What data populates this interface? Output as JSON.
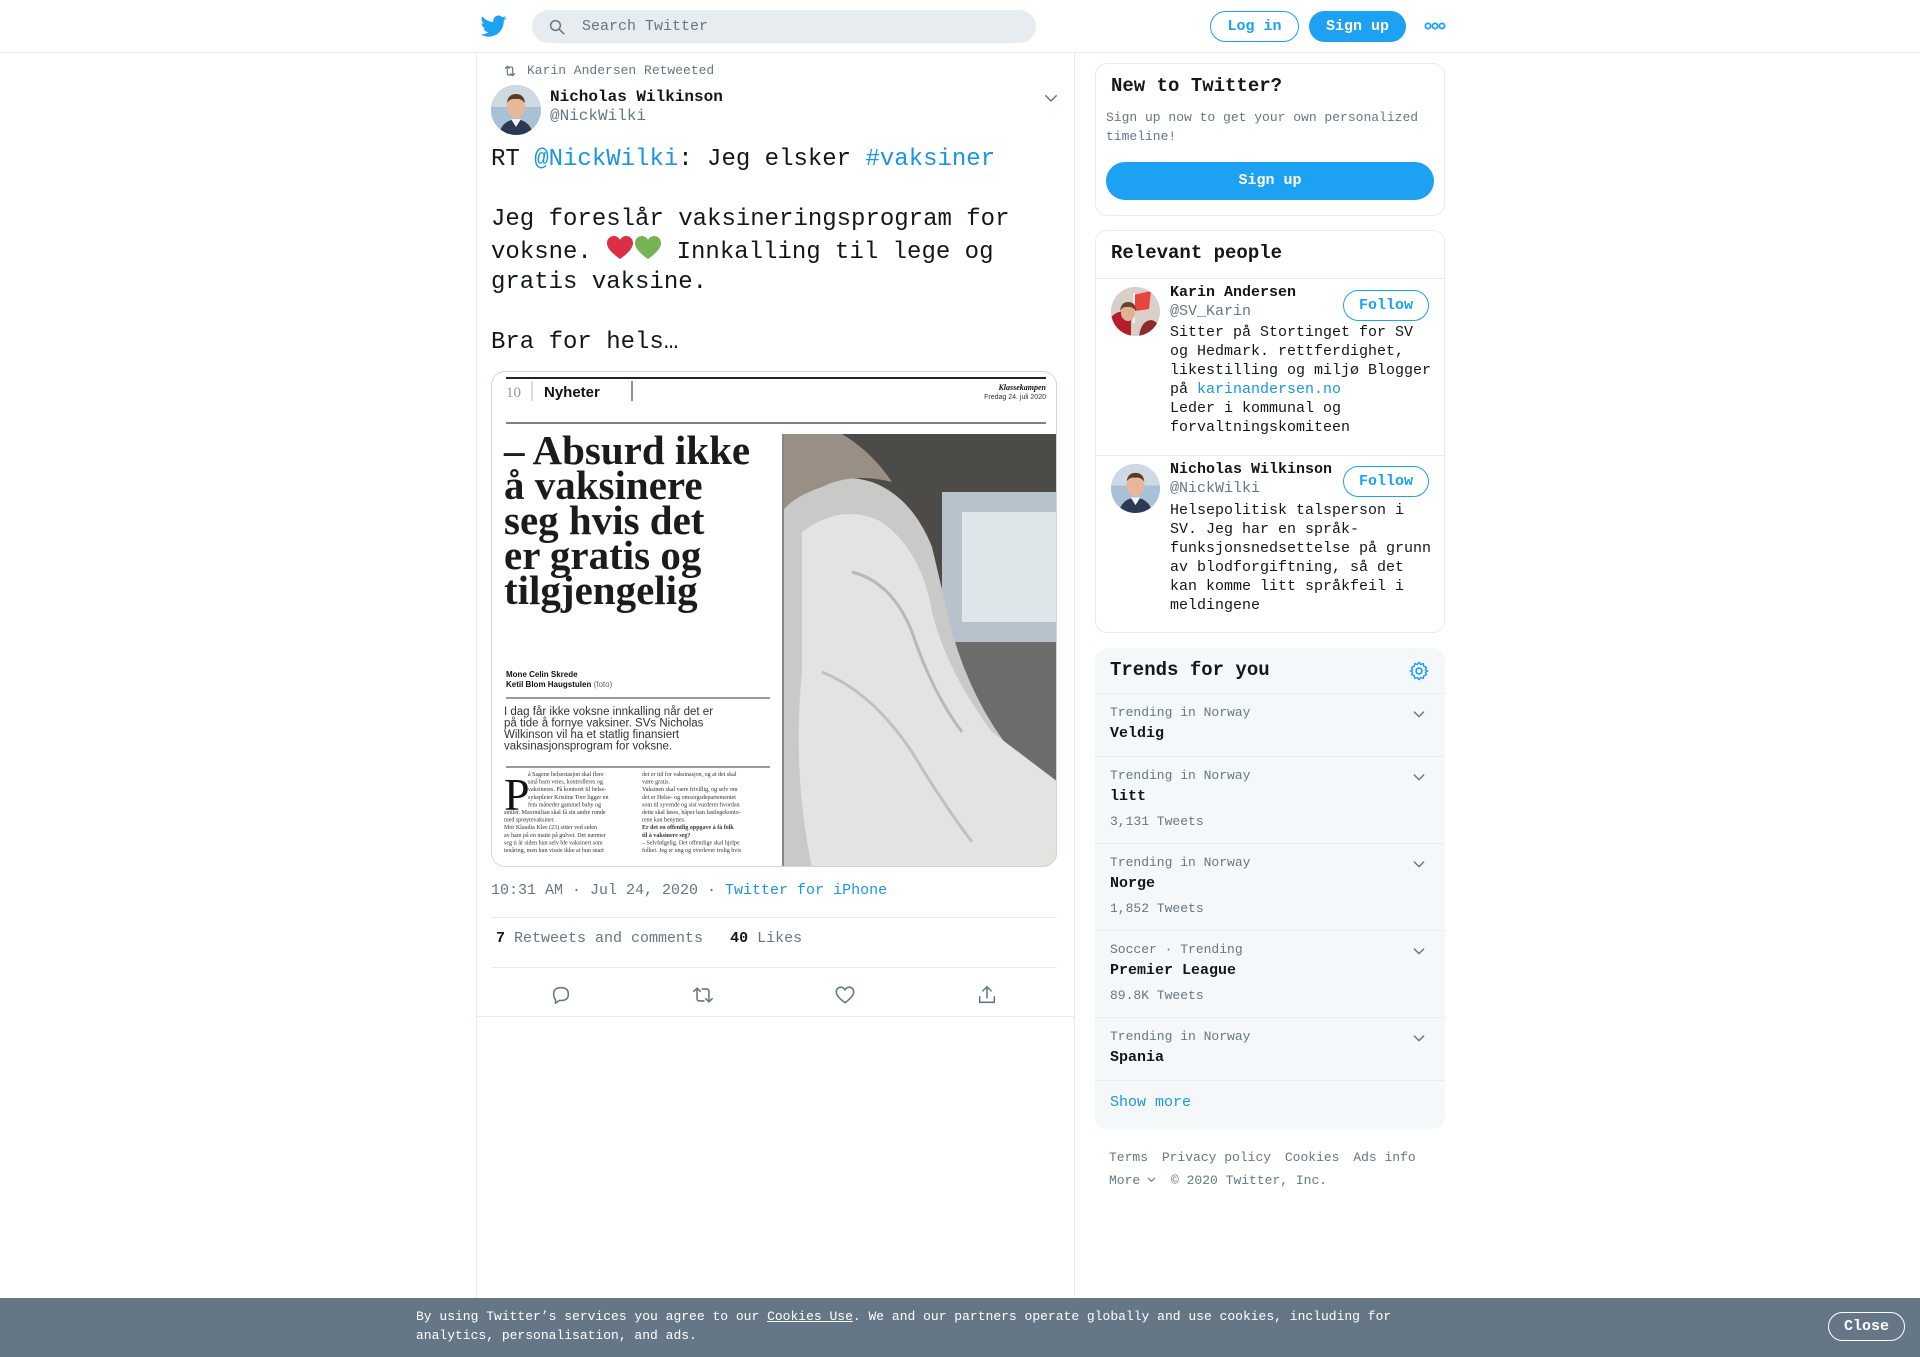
{
  "header": {
    "search_placeholder": "Search Twitter",
    "login_label": "Log in",
    "signup_label": "Sign up",
    "icons": [
      "twitter-bird-icon",
      "search-icon",
      "more-dots-icon"
    ],
    "brand_color": "#1da1f2"
  },
  "tweet": {
    "retweeted_by": "Karin Andersen Retweeted",
    "author_name": "Nicholas Wilkinson",
    "author_handle": "@NickWilki",
    "text_rt": "RT ",
    "text_mention": "@NickWilki",
    "text_mid": ": Jeg elsker ",
    "text_hashtag": "#vaksiner",
    "text_line2": "Jeg foreslår vaksineringsprogram for",
    "text_line3a": "voksne. ",
    "text_line3b": " Innkalling til lege og",
    "text_line4": "gratis vaksine.",
    "text_line5": "Bra for hels…",
    "timestamp": "10:31 AM · Jul 24, 2020 · ",
    "source": "Twitter for iPhone",
    "retweets_count": "7",
    "retweets_label": " Retweets and comments",
    "likes_count": "40",
    "likes_label": " Likes",
    "media": {
      "page_number": "10",
      "section": "Nyheter",
      "paper": "Klassekampen",
      "date": "Fredag 24. juli 2020",
      "headline": [
        "– Absurd ikke",
        "å vaksinere",
        "seg hvis det",
        "er gratis og",
        "tilgjengelig"
      ],
      "byline1": "Mone Celin Skrede",
      "byline2": "Ketil Blom Haugstulen",
      "byline2_suffix": " (foto)",
      "lead": [
        "I dag får ikke voksne innkalling når det er",
        "på tide å fornye vaksiner. SVs Nicholas",
        "Wilkinson vil ha et statlig finansiert",
        "vaksinasjonsprogram for voksne."
      ],
      "drop_cap": "P",
      "body_left": [
        "å Sagene helsestasjon skal flere",
        "små barn veies, kontrolleres og",
        "vaksineres. På kontoret til helse-",
        "sykepleier Kristine Tore ligger en",
        "fem måneder gammel baby og",
        "smiler. Maximilian skal få sin andre runde",
        "med sprøytevaksiner.",
        "Mor Klaudia Klee (23) sitter ved siden",
        "av ham på en matte på gulvet. Det nærmer",
        "seg ti år siden hun selv ble vaksinert som",
        "tenåring, men hun visste ikke at hun snart"
      ],
      "body_right": [
        "det er tid for vaksinasjon, og at det skal",
        "være gratis.",
        "Vaksinen skal være frivillig, og selv om",
        "det er Helse- og omsorgsdepartementet",
        "som til syvende og sist vurderer hvordan",
        "dette skal løses, håper han fastlegekonto-",
        "rene kan benyttes.",
        "Er det en offentlig oppgave å få folk",
        "til å vaksinere seg?",
        "– Selvfølgelig. Det offentlige skal hjelpe",
        "folket. Jeg er ung og overlever trolig hvis"
      ]
    },
    "icons": [
      "retweet-icon",
      "chevron-down-icon",
      "reply-icon",
      "retweet-action-icon",
      "like-icon",
      "share-icon",
      "red-heart-emoji",
      "green-heart-emoji"
    ]
  },
  "new_to_twitter": {
    "title": "New to Twitter?",
    "description": "Sign up now to get your own personalized timeline!",
    "signup_label": "Sign up"
  },
  "relevant_people": {
    "title": "Relevant people",
    "people": [
      {
        "name": "Karin Andersen",
        "handle": "@SV_Karin",
        "follow_label": "Follow",
        "bio_a": "Sitter på Stortinget for SV og Hedmark. rettferdighet, likestilling og miljø Blogger på ",
        "bio_link": "karinandersen.no",
        "bio_b": "Leder i kommunal og forvaltningskomiteen"
      },
      {
        "name": "Nicholas Wilkinson",
        "handle": "@NickWilki",
        "follow_label": "Follow",
        "bio": "Helsepolitisk talsperson i SV. Jeg har en språk-funksjonsnedsettelse på grunn av blodforgiftning, så det kan komme litt språkfeil i meldingene"
      }
    ]
  },
  "trends": {
    "title": "Trends for you",
    "items": [
      {
        "meta": "Trending in Norway",
        "name": "Veldig",
        "count": ""
      },
      {
        "meta": "Trending in Norway",
        "name": "litt",
        "count": "3,131 Tweets"
      },
      {
        "meta": "Trending in Norway",
        "name": "Norge",
        "count": "1,852 Tweets"
      },
      {
        "meta": "Soccer · Trending",
        "name": "Premier League",
        "count": "89.8K Tweets"
      },
      {
        "meta": "Trending in Norway",
        "name": "Spania",
        "count": ""
      }
    ],
    "show_more": "Show more",
    "icons": [
      "gear-icon",
      "chevron-down-icon"
    ]
  },
  "footer": {
    "links": [
      "Terms",
      "Privacy policy",
      "Cookies",
      "Ads info"
    ],
    "more_label": "More",
    "copyright": "© 2020 Twitter, Inc."
  },
  "cookie_bar": {
    "text_a": "By using Twitter’s services you agree to our ",
    "link": "Cookies Use",
    "text_b": ". We and our partners operate globally and use cookies, including for analytics, personalisation, and ads.",
    "close_label": "Close",
    "background": "#657786"
  }
}
